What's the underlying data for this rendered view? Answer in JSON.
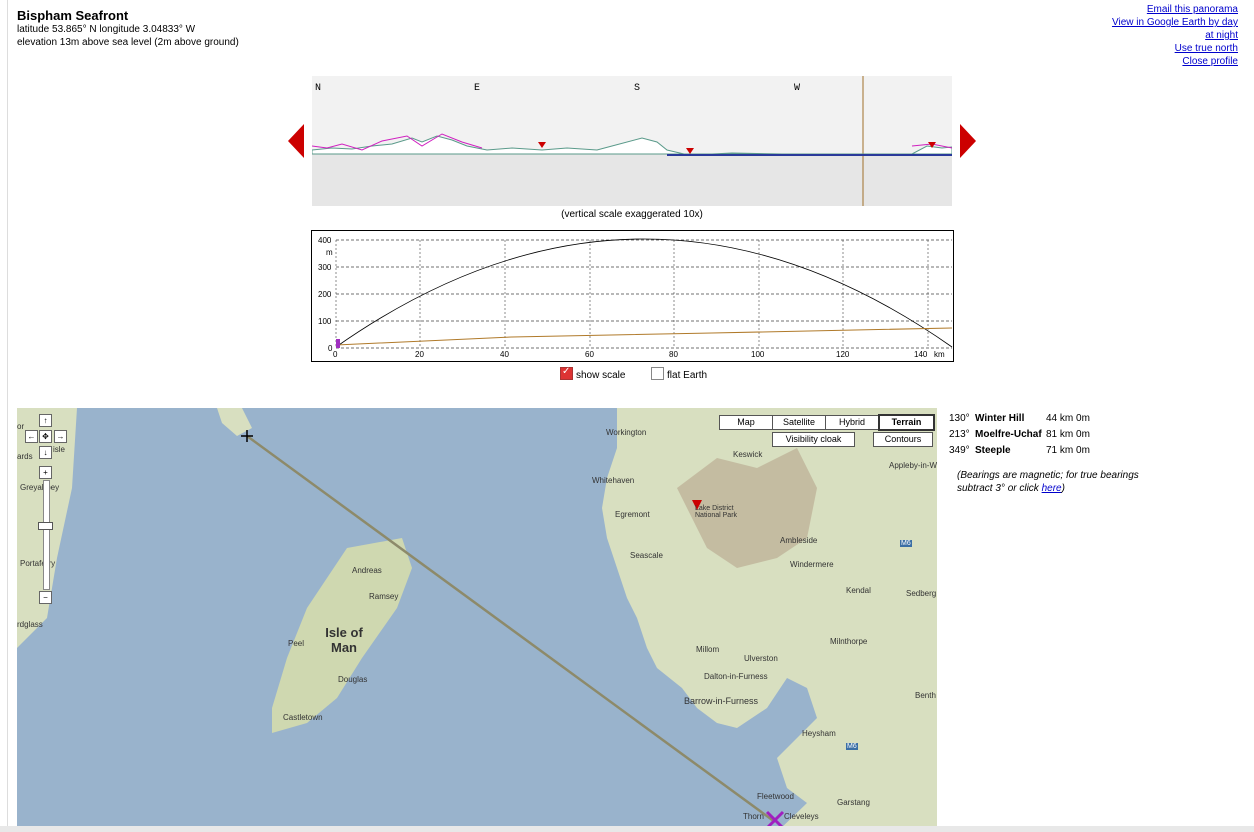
{
  "header": {
    "title": "Bispham Seafront",
    "coords": "latitude 53.865° N longitude 3.04833° W",
    "elevation": "elevation 13m above sea level (2m above ground)"
  },
  "links": {
    "email": "Email this panorama",
    "google_earth": "View in Google Earth by day",
    "at_night": "at night",
    "true_north": "Use true north",
    "close_profile": "Close profile"
  },
  "panorama": {
    "compass": [
      "N",
      "E",
      "S",
      "W"
    ],
    "caption": "(vertical scale exaggerated 10x)"
  },
  "profile": {
    "y_ticks": [
      "400",
      "300",
      "200",
      "100",
      "0"
    ],
    "y_unit": "m",
    "x_ticks": [
      "0",
      "20",
      "40",
      "60",
      "80",
      "100",
      "120",
      "140"
    ],
    "x_unit": "km"
  },
  "options": {
    "show_scale": "show scale",
    "flat_earth": "flat Earth",
    "show_scale_checked": true,
    "flat_earth_checked": false
  },
  "map": {
    "buttons": [
      "Map",
      "Satellite",
      "Hybrid",
      "Terrain"
    ],
    "selected": "Terrain",
    "visibility_cloak": "Visibility cloak",
    "contours": "Contours",
    "labels": {
      "workington": "Workington",
      "keswick": "Keswick",
      "appleby": "Appleby-in-W",
      "whitehaven": "Whitehaven",
      "egremont": "Egremont",
      "lake_district": "Lake District\nNational Park",
      "seascale": "Seascale",
      "ambleside": "Ambleside",
      "windermere": "Windermere",
      "kendal": "Kendal",
      "sedbergh": "Sedberg",
      "andreas": "Andreas",
      "ramsey": "Ramsey",
      "isle_of_man": "Isle of Man",
      "peel": "Peel",
      "douglas": "Douglas",
      "castletown": "Castletown",
      "millom": "Millom",
      "ulverston": "Ulverston",
      "milnthorpe": "Milnthorpe",
      "dalton": "Dalton-in-Furness",
      "barrow": "Barrow-in-Furness",
      "bentham": "Benth",
      "heysham": "Heysham",
      "fleetwood": "Fleetwood",
      "carstang": "Garstang",
      "thornton": "Thorn",
      "cleveleys": "Cleveleys",
      "greyabbey": "Greyabbey",
      "portaferry": "Portaferry",
      "ards": "ards",
      "isle": "isle",
      "or": "or",
      "ardglass": "rdglass",
      "m6a": "M6",
      "m6b": "M6"
    }
  },
  "peaks": [
    {
      "bearing": "130°",
      "name": "Winter Hill",
      "distance": "44 km 0m"
    },
    {
      "bearing": "213°",
      "name": "Moelfre-Uchaf",
      "distance": "81 km 0m"
    },
    {
      "bearing": "349°",
      "name": "Steeple",
      "distance": "71 km 0m"
    }
  ],
  "note": {
    "text": "(Bearings are magnetic; for true bearings subtract 3° or click ",
    "link": "here",
    "close": ")"
  }
}
